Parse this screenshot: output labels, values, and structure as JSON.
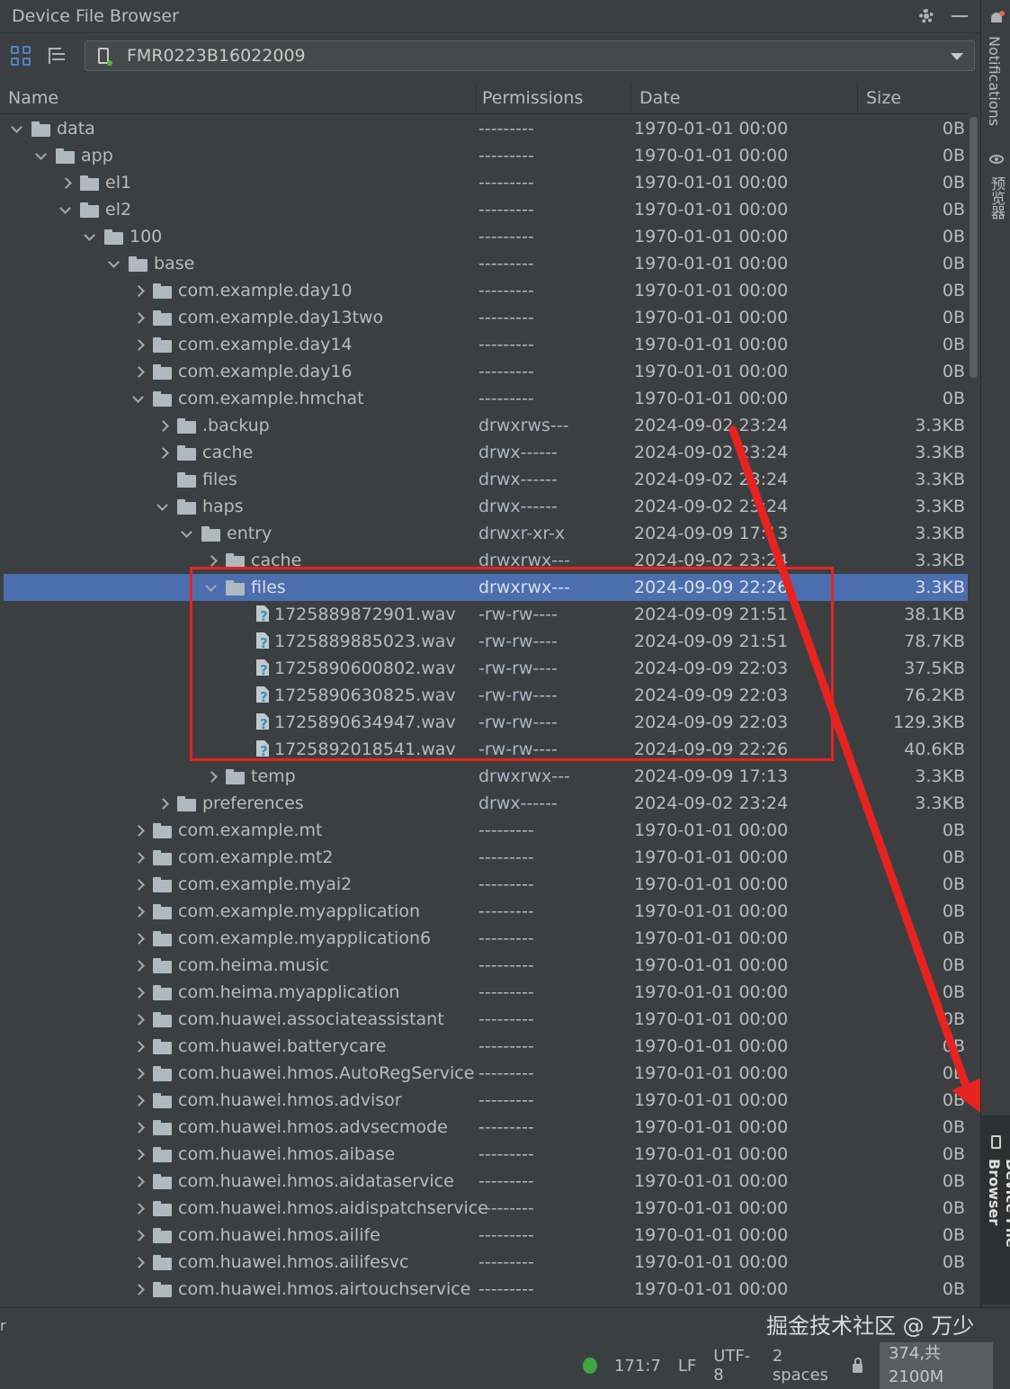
{
  "window": {
    "title": "Device File Browser"
  },
  "toolbar": {
    "device": "FMR0223B16022009"
  },
  "columns": {
    "name": "Name",
    "permissions": "Permissions",
    "date": "Date",
    "size": "Size"
  },
  "rows": [
    {
      "level": 0,
      "arrow": "expanded",
      "icon": "folder",
      "name": "data",
      "perm": "---------",
      "date": "1970-01-01 00:00",
      "size": "0B"
    },
    {
      "level": 1,
      "arrow": "expanded",
      "icon": "folder",
      "name": "app",
      "perm": "---------",
      "date": "1970-01-01 00:00",
      "size": "0B"
    },
    {
      "level": 2,
      "arrow": "collapsed",
      "icon": "folder",
      "name": "el1",
      "perm": "---------",
      "date": "1970-01-01 00:00",
      "size": "0B"
    },
    {
      "level": 2,
      "arrow": "expanded",
      "icon": "folder",
      "name": "el2",
      "perm": "---------",
      "date": "1970-01-01 00:00",
      "size": "0B"
    },
    {
      "level": 3,
      "arrow": "expanded",
      "icon": "folder",
      "name": "100",
      "perm": "---------",
      "date": "1970-01-01 00:00",
      "size": "0B"
    },
    {
      "level": 4,
      "arrow": "expanded",
      "icon": "folder",
      "name": "base",
      "perm": "---------",
      "date": "1970-01-01 00:00",
      "size": "0B"
    },
    {
      "level": 5,
      "arrow": "collapsed",
      "icon": "folder",
      "name": "com.example.day10",
      "perm": "---------",
      "date": "1970-01-01 00:00",
      "size": "0B"
    },
    {
      "level": 5,
      "arrow": "collapsed",
      "icon": "folder",
      "name": "com.example.day13two",
      "perm": "---------",
      "date": "1970-01-01 00:00",
      "size": "0B"
    },
    {
      "level": 5,
      "arrow": "collapsed",
      "icon": "folder",
      "name": "com.example.day14",
      "perm": "---------",
      "date": "1970-01-01 00:00",
      "size": "0B"
    },
    {
      "level": 5,
      "arrow": "collapsed",
      "icon": "folder",
      "name": "com.example.day16",
      "perm": "---------",
      "date": "1970-01-01 00:00",
      "size": "0B"
    },
    {
      "level": 5,
      "arrow": "expanded",
      "icon": "folder",
      "name": "com.example.hmchat",
      "perm": "---------",
      "date": "1970-01-01 00:00",
      "size": "0B"
    },
    {
      "level": 6,
      "arrow": "collapsed",
      "icon": "folder",
      "name": ".backup",
      "perm": "drwxrws---",
      "date": "2024-09-02 23:24",
      "size": "3.3KB"
    },
    {
      "level": 6,
      "arrow": "collapsed",
      "icon": "folder",
      "name": "cache",
      "perm": "drwx------",
      "date": "2024-09-02 23:24",
      "size": "3.3KB"
    },
    {
      "level": 6,
      "arrow": "none",
      "icon": "folder",
      "name": "files",
      "perm": "drwx------",
      "date": "2024-09-02 23:24",
      "size": "3.3KB"
    },
    {
      "level": 6,
      "arrow": "expanded",
      "icon": "folder",
      "name": "haps",
      "perm": "drwx------",
      "date": "2024-09-02 23:24",
      "size": "3.3KB"
    },
    {
      "level": 7,
      "arrow": "expanded",
      "icon": "folder",
      "name": "entry",
      "perm": "drwxr-xr-x",
      "date": "2024-09-09 17:13",
      "size": "3.3KB"
    },
    {
      "level": 8,
      "arrow": "collapsed",
      "icon": "folder",
      "name": "cache",
      "perm": "drwxrwx---",
      "date": "2024-09-02 23:24",
      "size": "3.3KB"
    },
    {
      "level": 8,
      "arrow": "expanded",
      "icon": "folder",
      "name": "files",
      "perm": "drwxrwx---",
      "date": "2024-09-09 22:26",
      "size": "3.3KB",
      "selected": true
    },
    {
      "level": 9,
      "arrow": "none",
      "icon": "file",
      "name": "1725889872901.wav",
      "perm": "-rw-rw----",
      "date": "2024-09-09 21:51",
      "size": "38.1KB"
    },
    {
      "level": 9,
      "arrow": "none",
      "icon": "file",
      "name": "1725889885023.wav",
      "perm": "-rw-rw----",
      "date": "2024-09-09 21:51",
      "size": "78.7KB"
    },
    {
      "level": 9,
      "arrow": "none",
      "icon": "file",
      "name": "1725890600802.wav",
      "perm": "-rw-rw----",
      "date": "2024-09-09 22:03",
      "size": "37.5KB"
    },
    {
      "level": 9,
      "arrow": "none",
      "icon": "file",
      "name": "1725890630825.wav",
      "perm": "-rw-rw----",
      "date": "2024-09-09 22:03",
      "size": "76.2KB"
    },
    {
      "level": 9,
      "arrow": "none",
      "icon": "file",
      "name": "1725890634947.wav",
      "perm": "-rw-rw----",
      "date": "2024-09-09 22:03",
      "size": "129.3KB"
    },
    {
      "level": 9,
      "arrow": "none",
      "icon": "file",
      "name": "1725892018541.wav",
      "perm": "-rw-rw----",
      "date": "2024-09-09 22:26",
      "size": "40.6KB"
    },
    {
      "level": 8,
      "arrow": "collapsed",
      "icon": "folder",
      "name": "temp",
      "perm": "drwxrwx---",
      "date": "2024-09-09 17:13",
      "size": "3.3KB"
    },
    {
      "level": 6,
      "arrow": "collapsed",
      "icon": "folder",
      "name": "preferences",
      "perm": "drwx------",
      "date": "2024-09-02 23:24",
      "size": "3.3KB"
    },
    {
      "level": 5,
      "arrow": "collapsed",
      "icon": "folder",
      "name": "com.example.mt",
      "perm": "---------",
      "date": "1970-01-01 00:00",
      "size": "0B"
    },
    {
      "level": 5,
      "arrow": "collapsed",
      "icon": "folder",
      "name": "com.example.mt2",
      "perm": "---------",
      "date": "1970-01-01 00:00",
      "size": "0B"
    },
    {
      "level": 5,
      "arrow": "collapsed",
      "icon": "folder",
      "name": "com.example.myai2",
      "perm": "---------",
      "date": "1970-01-01 00:00",
      "size": "0B"
    },
    {
      "level": 5,
      "arrow": "collapsed",
      "icon": "folder",
      "name": "com.example.myapplication",
      "perm": "---------",
      "date": "1970-01-01 00:00",
      "size": "0B"
    },
    {
      "level": 5,
      "arrow": "collapsed",
      "icon": "folder",
      "name": "com.example.myapplication6",
      "perm": "---------",
      "date": "1970-01-01 00:00",
      "size": "0B"
    },
    {
      "level": 5,
      "arrow": "collapsed",
      "icon": "folder",
      "name": "com.heima.music",
      "perm": "---------",
      "date": "1970-01-01 00:00",
      "size": "0B"
    },
    {
      "level": 5,
      "arrow": "collapsed",
      "icon": "folder",
      "name": "com.heima.myapplication",
      "perm": "---------",
      "date": "1970-01-01 00:00",
      "size": "0B"
    },
    {
      "level": 5,
      "arrow": "collapsed",
      "icon": "folder",
      "name": "com.huawei.associateassistant",
      "perm": "---------",
      "date": "1970-01-01 00:00",
      "size": "0B"
    },
    {
      "level": 5,
      "arrow": "collapsed",
      "icon": "folder",
      "name": "com.huawei.batterycare",
      "perm": "---------",
      "date": "1970-01-01 00:00",
      "size": "0B"
    },
    {
      "level": 5,
      "arrow": "collapsed",
      "icon": "folder",
      "name": "com.huawei.hmos.AutoRegService",
      "perm": "---------",
      "date": "1970-01-01 00:00",
      "size": "0B"
    },
    {
      "level": 5,
      "arrow": "collapsed",
      "icon": "folder",
      "name": "com.huawei.hmos.advisor",
      "perm": "---------",
      "date": "1970-01-01 00:00",
      "size": "0B"
    },
    {
      "level": 5,
      "arrow": "collapsed",
      "icon": "folder",
      "name": "com.huawei.hmos.advsecmode",
      "perm": "---------",
      "date": "1970-01-01 00:00",
      "size": "0B"
    },
    {
      "level": 5,
      "arrow": "collapsed",
      "icon": "folder",
      "name": "com.huawei.hmos.aibase",
      "perm": "---------",
      "date": "1970-01-01 00:00",
      "size": "0B"
    },
    {
      "level": 5,
      "arrow": "collapsed",
      "icon": "folder",
      "name": "com.huawei.hmos.aidataservice",
      "perm": "---------",
      "date": "1970-01-01 00:00",
      "size": "0B"
    },
    {
      "level": 5,
      "arrow": "collapsed",
      "icon": "folder",
      "name": "com.huawei.hmos.aidispatchservice",
      "perm": "---------",
      "date": "1970-01-01 00:00",
      "size": "0B"
    },
    {
      "level": 5,
      "arrow": "collapsed",
      "icon": "folder",
      "name": "com.huawei.hmos.ailife",
      "perm": "---------",
      "date": "1970-01-01 00:00",
      "size": "0B"
    },
    {
      "level": 5,
      "arrow": "collapsed",
      "icon": "folder",
      "name": "com.huawei.hmos.ailifesvc",
      "perm": "---------",
      "date": "1970-01-01 00:00",
      "size": "0B"
    },
    {
      "level": 5,
      "arrow": "collapsed",
      "icon": "folder",
      "name": "com.huawei.hmos.airtouchservice",
      "perm": "---------",
      "date": "1970-01-01 00:00",
      "size": "0B"
    }
  ],
  "side_tabs": {
    "notifications": "Notifications",
    "previewer": "预览器",
    "device_file_browser": "Device File Browser"
  },
  "status": {
    "position": "171:7",
    "line_ending": "LF",
    "encoding": "UTF-8",
    "indent": "2 spaces",
    "memory": "374,共2100M",
    "left_fragment": "r"
  },
  "watermark": "掘金技术社区 @ 万少",
  "colors": {
    "background": "#3c3f41",
    "selection": "#4b6eaf",
    "annotation_red": "#e8231f",
    "status_ok": "#3ea543"
  },
  "icons": {
    "title_actions": [
      "gear-icon",
      "minimize-icon"
    ],
    "toolbar": [
      "grid-icon",
      "tree-icon",
      "phone-icon",
      "chevron-down-icon"
    ]
  }
}
